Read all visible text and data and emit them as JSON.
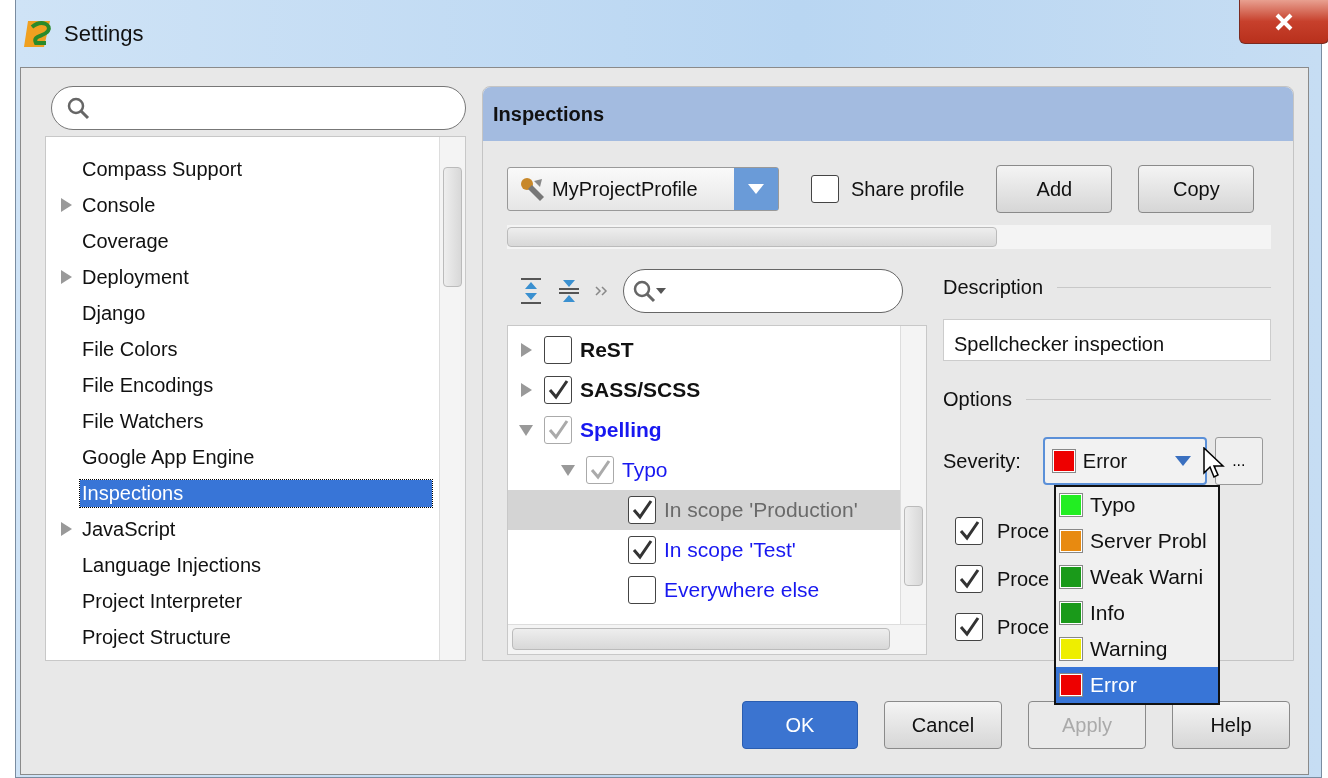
{
  "window": {
    "title": "Settings"
  },
  "sidebar": {
    "items": [
      {
        "label": "Compass Support",
        "expandable": false,
        "selected": false
      },
      {
        "label": "Console",
        "expandable": true,
        "selected": false
      },
      {
        "label": "Coverage",
        "expandable": false,
        "selected": false
      },
      {
        "label": "Deployment",
        "expandable": true,
        "selected": false
      },
      {
        "label": "Django",
        "expandable": false,
        "selected": false
      },
      {
        "label": "File Colors",
        "expandable": false,
        "selected": false
      },
      {
        "label": "File Encodings",
        "expandable": false,
        "selected": false
      },
      {
        "label": "File Watchers",
        "expandable": false,
        "selected": false
      },
      {
        "label": "Google App Engine",
        "expandable": false,
        "selected": false
      },
      {
        "label": "Inspections",
        "expandable": false,
        "selected": true
      },
      {
        "label": "JavaScript",
        "expandable": true,
        "selected": false
      },
      {
        "label": "Language Injections",
        "expandable": false,
        "selected": false
      },
      {
        "label": "Project Interpreter",
        "expandable": false,
        "selected": false
      },
      {
        "label": "Project Structure",
        "expandable": false,
        "selected": false
      }
    ]
  },
  "panel": {
    "title": "Inspections",
    "profile": {
      "value": "MyProjectProfile"
    },
    "share_profile": {
      "label": "Share profile",
      "checked": false
    },
    "buttons": [
      {
        "label": "Add"
      },
      {
        "label": "Copy"
      }
    ],
    "tree": [
      {
        "label": "ReST",
        "kind": "group",
        "checked": false,
        "partial": false,
        "expanded": false,
        "modified": false,
        "selected": false
      },
      {
        "label": "SASS/SCSS",
        "kind": "group",
        "checked": true,
        "partial": false,
        "expanded": false,
        "modified": false,
        "selected": false
      },
      {
        "label": "Spelling",
        "kind": "group",
        "checked": true,
        "partial": true,
        "expanded": true,
        "modified": true,
        "selected": false,
        "children": [
          {
            "label": "Typo",
            "kind": "inspection",
            "checked": true,
            "partial": true,
            "expanded": true,
            "modified": true,
            "selected": false,
            "children": [
              {
                "label": "In scope 'Production'",
                "kind": "scope",
                "checked": true,
                "partial": false,
                "modified": true,
                "selected": true
              },
              {
                "label": "In scope 'Test'",
                "kind": "scope",
                "checked": true,
                "partial": false,
                "modified": true,
                "selected": false
              },
              {
                "label": "Everywhere else",
                "kind": "scope",
                "checked": false,
                "partial": false,
                "modified": true,
                "selected": false
              }
            ]
          }
        ]
      }
    ],
    "description": {
      "heading": "Description",
      "text": "Spellchecker inspection"
    },
    "options": {
      "heading": "Options",
      "severity_label": "Severity:",
      "severity": {
        "label": "Error",
        "color": "#ee0000"
      },
      "more": "...",
      "checkboxes": [
        {
          "label": "Proce",
          "checked": true
        },
        {
          "label": "Proce",
          "checked": true
        },
        {
          "label": "Proce",
          "checked": true
        }
      ]
    },
    "severity_menu": [
      {
        "label": "Typo",
        "color": "#22ee22",
        "selected": false
      },
      {
        "label": "Server Probl",
        "color": "#e88a10",
        "selected": false
      },
      {
        "label": "Weak Warni",
        "color": "#1a9a1a",
        "selected": false
      },
      {
        "label": "Info",
        "color": "#1a9a1a",
        "selected": false
      },
      {
        "label": "Warning",
        "color": "#eeee00",
        "selected": false
      },
      {
        "label": "Error",
        "color": "#ee0000",
        "selected": true
      }
    ]
  },
  "dialog_buttons": [
    {
      "label": "OK",
      "default": true,
      "disabled": false
    },
    {
      "label": "Cancel",
      "default": false,
      "disabled": false
    },
    {
      "label": "Apply",
      "default": false,
      "disabled": true
    },
    {
      "label": "Help",
      "default": false,
      "disabled": false
    }
  ]
}
